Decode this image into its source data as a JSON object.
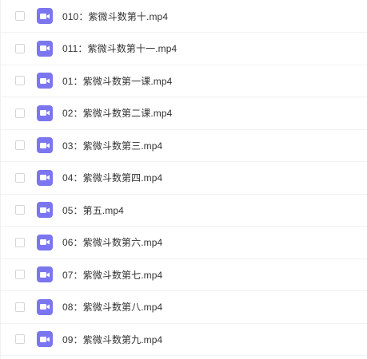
{
  "file_list": {
    "icon": "video-file-icon",
    "icon_color": "#7b76f0",
    "items": [
      {
        "name": "010：紫微斗数第十.mp4"
      },
      {
        "name": "011：紫微斗数第十一.mp4"
      },
      {
        "name": "01：紫微斗数第一课.mp4"
      },
      {
        "name": "02：紫微斗数第二课.mp4"
      },
      {
        "name": "03：紫微斗数第三.mp4"
      },
      {
        "name": "04：紫微斗数第四.mp4"
      },
      {
        "name": "05：第五.mp4"
      },
      {
        "name": "06：紫微斗数第六.mp4"
      },
      {
        "name": "07：紫微斗数第七.mp4"
      },
      {
        "name": "08：紫微斗数第八.mp4"
      },
      {
        "name": "09：紫微斗数第九.mp4"
      }
    ]
  }
}
